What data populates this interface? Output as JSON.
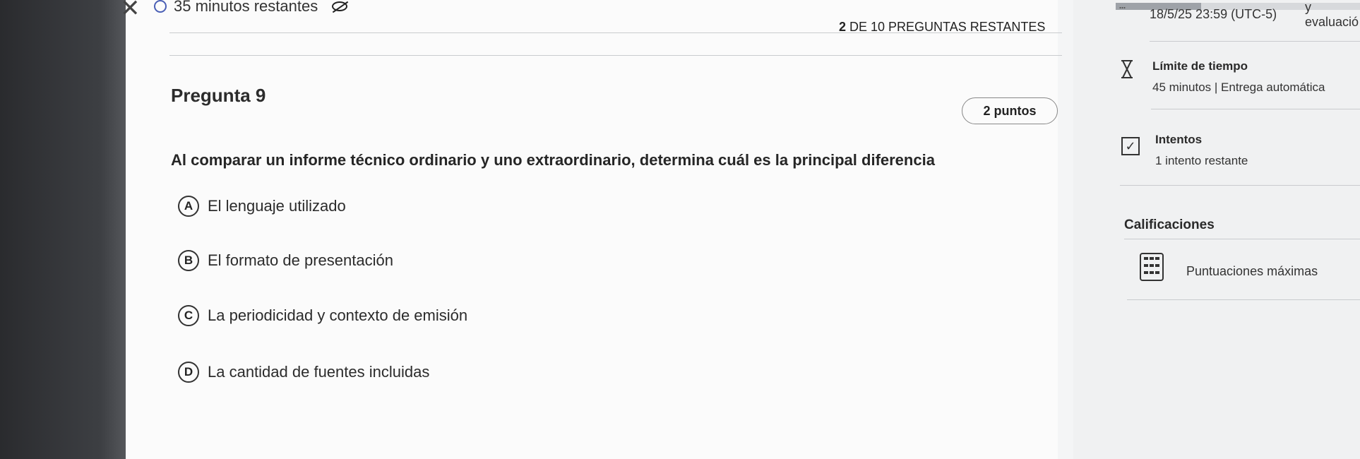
{
  "header": {
    "timer_text": "35 minutos restantes",
    "questions_remaining_bold": "2",
    "questions_remaining_rest": " DE 10 PREGUNTAS RESTANTES",
    "progress_fraction": 0.35,
    "due_date": "18/5/25 23:59 (UTC-5)",
    "corner_text": "y evaluació"
  },
  "question": {
    "title": "Pregunta 9",
    "points": "2 puntos",
    "prompt": "Al comparar un informe técnico ordinario y uno extraordinario, determina cuál es la principal diferencia",
    "options": [
      {
        "letter": "A",
        "text": "El lenguaje utilizado"
      },
      {
        "letter": "B",
        "text": "El formato de presentación"
      },
      {
        "letter": "C",
        "text": "La periodicidad y contexto de emisión"
      },
      {
        "letter": "D",
        "text": "La cantidad de fuentes incluidas"
      }
    ]
  },
  "sidebar": {
    "time_limit_title": "Límite de tiempo",
    "time_limit_detail": "45 minutos | Entrega automática",
    "attempts_title": "Intentos",
    "attempts_detail": "1 intento restante",
    "grades_title": "Calificaciones",
    "max_scores_label": "Puntuaciones máximas"
  },
  "icons": {
    "close": "close-icon",
    "clock": "clock-icon",
    "visibility": "eye-slash-icon",
    "time_limit": "hourglass-icon",
    "attempts": "checkbox-icon",
    "grades": "calculator-icon"
  },
  "colors": {
    "accent": "#4a5fb5",
    "progress_fill": "#9ea2a8"
  }
}
